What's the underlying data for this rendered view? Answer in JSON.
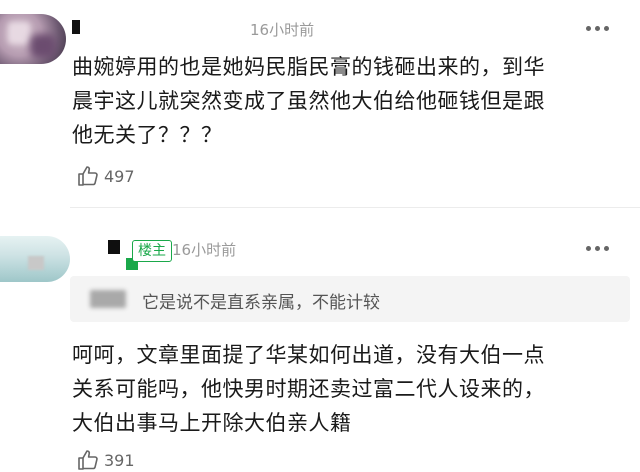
{
  "comment": {
    "time": "16小时前",
    "lines": [
      "曲婉婷用的也是她妈民脂民膏的钱砸出来的，到华",
      "晨宇这儿就突然变成了虽然他大伯给他砸钱但是跟",
      "他无关了？？？"
    ],
    "likes": "497"
  },
  "reply": {
    "badge": "楼主",
    "time": "16小时前",
    "quote": "它是说不是直系亲属，不能计较",
    "lines": [
      "呵呵，文章里面提了华某如何出道，没有大伯一点",
      "关系可能吗，他快男时期还卖过富二代人设来的，",
      "大伯出事马上开除大伯亲人籍"
    ],
    "likes": "391"
  },
  "colors": {
    "accent_green": "#1aa84a",
    "meta_gray": "#9a9a9a",
    "quote_bg": "#f4f4f4"
  },
  "icons": {
    "like": "thumbs-up-icon",
    "menu": "more-dots-icon"
  }
}
